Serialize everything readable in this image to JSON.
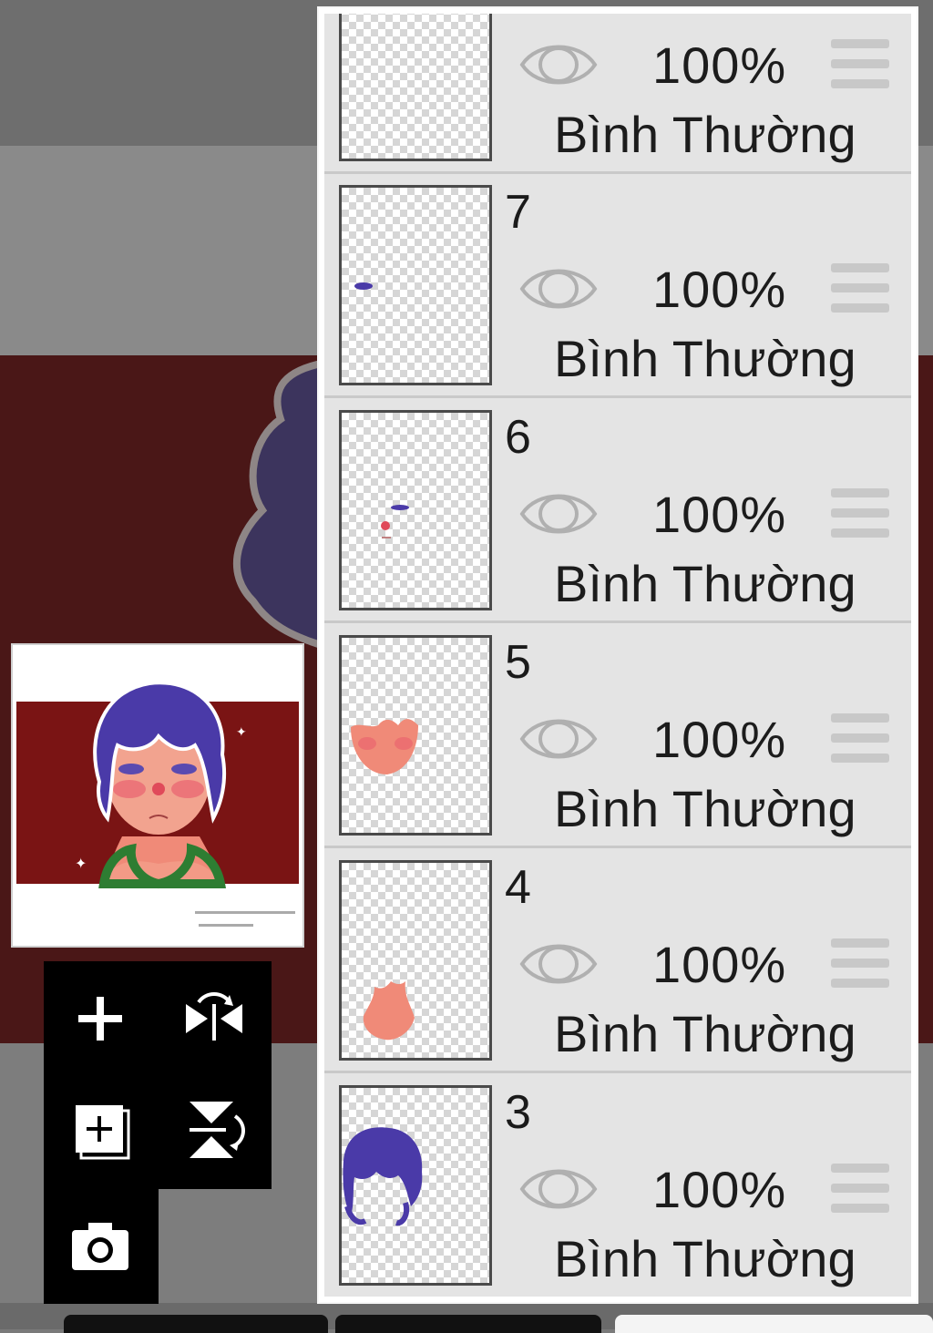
{
  "layers_panel": {
    "layers": [
      {
        "number": "",
        "opacity": "100%",
        "blend_mode": "Bình Thường",
        "visible": true
      },
      {
        "number": "7",
        "opacity": "100%",
        "blend_mode": "Bình Thường",
        "visible": true
      },
      {
        "number": "6",
        "opacity": "100%",
        "blend_mode": "Bình Thường",
        "visible": true
      },
      {
        "number": "5",
        "opacity": "100%",
        "blend_mode": "Bình Thường",
        "visible": true
      },
      {
        "number": "4",
        "opacity": "100%",
        "blend_mode": "Bình Thường",
        "visible": true
      },
      {
        "number": "3",
        "opacity": "100%",
        "blend_mode": "Bình Thường",
        "visible": true
      }
    ]
  },
  "tools": {
    "add_layer_icon": "plus-icon",
    "flip_horizontal_icon": "flip-horizontal-icon",
    "duplicate_layer_icon": "add-layer-copy-icon",
    "flip_vertical_icon": "flip-vertical-icon",
    "import_photo_icon": "camera-icon"
  },
  "colors": {
    "panel_bg": "#e5e5e5",
    "canvas_red": "#7a1414",
    "hair_purple": "#4a3aa8",
    "skin": "#f08a78",
    "sweater_green": "#2e7d32"
  }
}
